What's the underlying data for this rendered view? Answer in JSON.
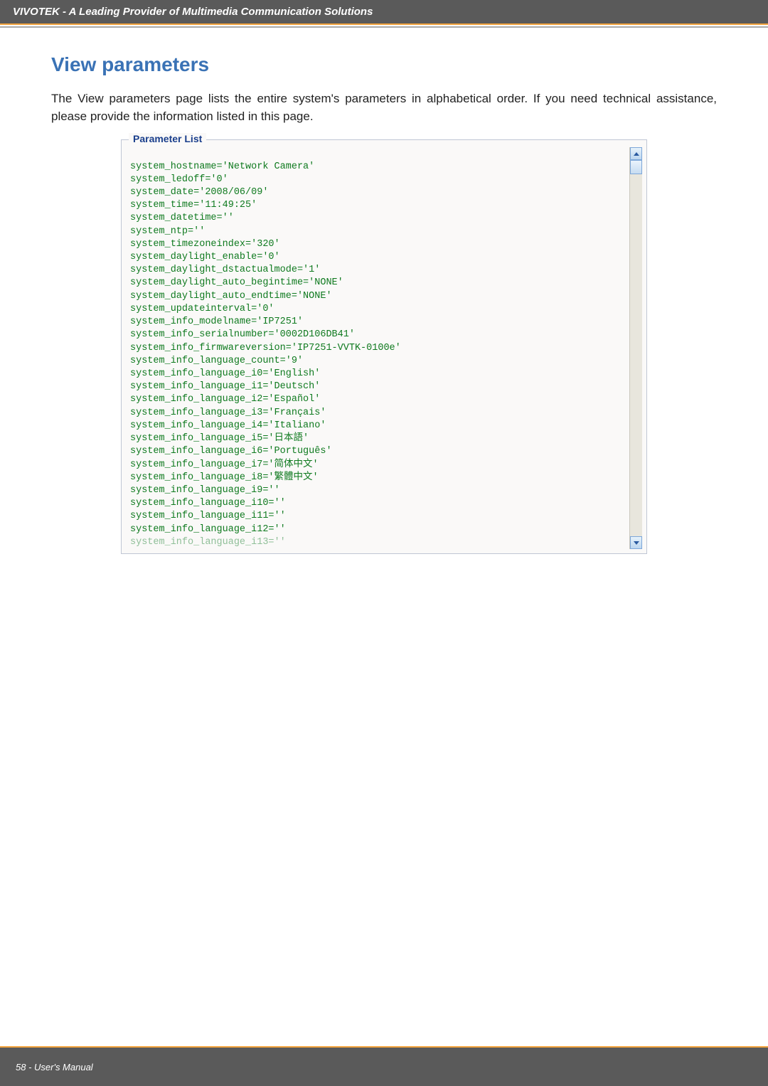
{
  "header": {
    "brandline": "VIVOTEK - A Leading Provider of Multimedia Communication Solutions"
  },
  "page": {
    "title": "View parameters",
    "intro": "The View parameters page lists the entire system's parameters in alphabetical order. If you need technical assistance, please provide the information listed in this page."
  },
  "panel": {
    "legend": "Parameter List"
  },
  "params": {
    "lines": [
      "",
      "system_hostname='Network Camera'",
      "system_ledoff='0'",
      "system_date='2008/06/09'",
      "system_time='11:49:25'",
      "system_datetime=''",
      "system_ntp=''",
      "system_timezoneindex='320'",
      "system_daylight_enable='0'",
      "system_daylight_dstactualmode='1'",
      "system_daylight_auto_begintime='NONE'",
      "system_daylight_auto_endtime='NONE'",
      "system_updateinterval='0'",
      "system_info_modelname='IP7251'",
      "system_info_serialnumber='0002D106DB41'",
      "system_info_firmwareversion='IP7251-VVTK-0100e'",
      "system_info_language_count='9'",
      "system_info_language_i0='English'",
      "system_info_language_i1='Deutsch'",
      "system_info_language_i2='Español'",
      "system_info_language_i3='Français'",
      "system_info_language_i4='Italiano'",
      "system_info_language_i5='日本語'",
      "system_info_language_i6='Português'",
      "system_info_language_i7='简体中文'",
      "system_info_language_i8='繁體中文'",
      "system_info_language_i9=''",
      "system_info_language_i10=''",
      "system_info_language_i11=''",
      "system_info_language_i12=''"
    ],
    "cutoff": "system_info_language_i13=''"
  },
  "footer": {
    "page_label": "58 - User's Manual"
  }
}
